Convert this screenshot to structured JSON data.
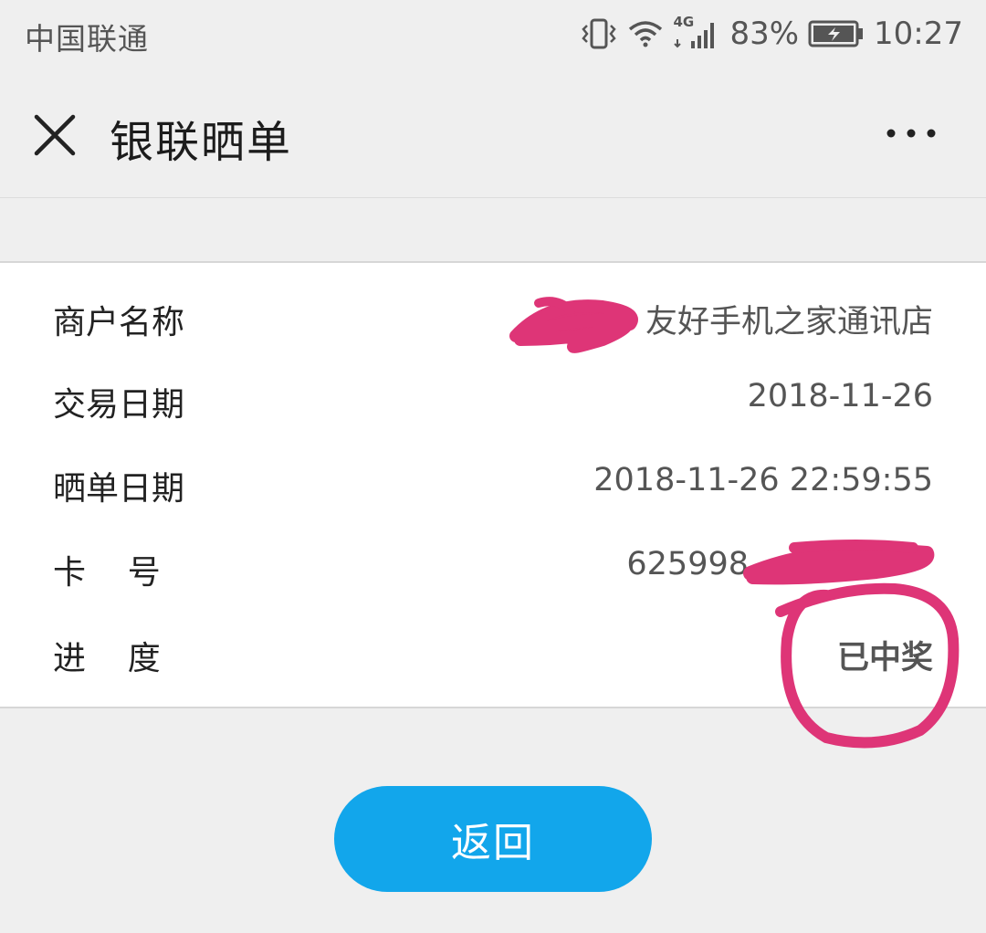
{
  "status_bar": {
    "carrier": "中国联通",
    "network_type": "4G",
    "battery": "83%",
    "time": "10:27",
    "icons": [
      "vibrate-icon",
      "wifi-icon",
      "signal-icon",
      "battery-charging-icon"
    ]
  },
  "header": {
    "title": "银联晒单",
    "close_icon": "close-icon",
    "more_icon": "more-icon"
  },
  "details": {
    "merchant": {
      "label": "商户名称",
      "value": "友好手机之家通讯店"
    },
    "trade_date": {
      "label": "交易日期",
      "value": "2018-11-26"
    },
    "share_date": {
      "label": "晒单日期",
      "value": "2018-11-26 22:59:55"
    },
    "card_no": {
      "label": "卡    号",
      "value": "625998"
    },
    "progress": {
      "label": "进    度",
      "value": "已中奖"
    }
  },
  "annotation_color": "#de3577",
  "back_button": {
    "label": "返回"
  }
}
